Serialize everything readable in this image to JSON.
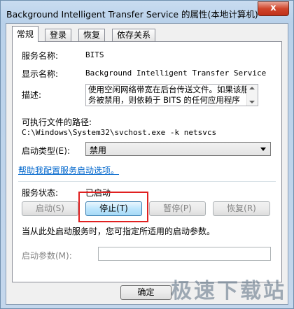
{
  "window": {
    "title": "Background Intelligent Transfer Service 的属性(本地计算机)",
    "close_glyph": "x"
  },
  "tabs": [
    {
      "label": "常规",
      "active": true
    },
    {
      "label": "登录",
      "active": false
    },
    {
      "label": "恢复",
      "active": false
    },
    {
      "label": "依存关系",
      "active": false
    }
  ],
  "general": {
    "service_name_label": "服务名称:",
    "service_name_value": "BITS",
    "display_name_label": "显示名称:",
    "display_name_value": "Background Intelligent Transfer Service",
    "description_label": "描述:",
    "description_value": "使用空闲网络带宽在后台传送文件。如果该服务被禁用，则依赖于 BITS 的任何应用程序(如",
    "exe_path_label": "可执行文件的路径:",
    "exe_path_value": "C:\\Windows\\System32\\svchost.exe -k netsvcs",
    "startup_type_label": "启动类型(E):",
    "startup_type_value": "禁用",
    "help_link": "帮助我配置服务启动选项。",
    "status_label": "服务状态:",
    "status_value": "已启动",
    "hint_text": "当从此处启动服务时，您可指定所适用的启动参数。",
    "params_label": "启动参数(M):",
    "params_value": ""
  },
  "service_buttons": {
    "start": "启动(S)",
    "stop": "停止(T)",
    "pause": "暂停(P)",
    "resume": "恢复(R)"
  },
  "footer": {
    "ok": "确定",
    "watermark": "极速下载站"
  },
  "colors": {
    "highlight": "#e02020",
    "link": "#0066cc"
  }
}
